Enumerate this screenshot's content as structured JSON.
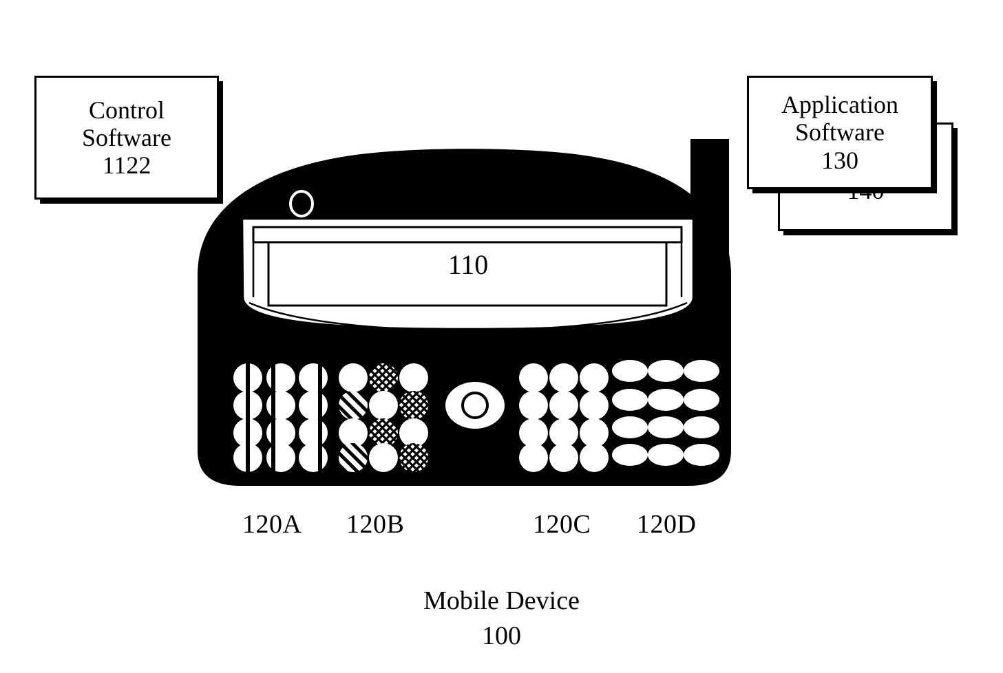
{
  "figure": {
    "caption_title": "Mobile Device",
    "caption_number": "100"
  },
  "callouts": {
    "control_software": {
      "line1": "Control",
      "line2": "Software",
      "number": "1122"
    },
    "application_software": {
      "line1": "Application",
      "line2": "Software",
      "number": "130"
    },
    "application_software_back": {
      "number": "140"
    }
  },
  "device": {
    "display": {
      "reference_number": "110"
    },
    "keypads": [
      {
        "id": "120A",
        "label": "120A",
        "rows": 4,
        "cols": 3,
        "key_shape": "circle-split",
        "patterns": [
          [
            "split-center",
            "split-left",
            "split-right"
          ],
          [
            "split-center",
            "split-left",
            "split-right"
          ],
          [
            "split-center",
            "split-left",
            "split-right"
          ],
          [
            "split-center",
            "split-left",
            "split-right"
          ]
        ]
      },
      {
        "id": "120B",
        "label": "120B",
        "rows": 4,
        "cols": 3,
        "key_shape": "circle",
        "patterns": [
          [
            "solid",
            "crosshatch",
            "solid"
          ],
          [
            "diagonal",
            "solid",
            "crosshatch"
          ],
          [
            "solid",
            "crosshatch",
            "solid"
          ],
          [
            "diagonal",
            "solid",
            "crosshatch"
          ]
        ]
      },
      {
        "id": "120C",
        "label": "120C",
        "rows": 4,
        "cols": 3,
        "key_shape": "circle",
        "patterns": [
          [
            "solid",
            "solid",
            "solid"
          ],
          [
            "solid",
            "solid",
            "solid"
          ],
          [
            "solid",
            "solid",
            "solid"
          ],
          [
            "solid",
            "solid",
            "solid"
          ]
        ]
      },
      {
        "id": "120D",
        "label": "120D",
        "rows": 4,
        "cols": 3,
        "key_shape": "ellipse-wide",
        "patterns": [
          [
            "solid",
            "solid",
            "solid"
          ],
          [
            "solid",
            "solid",
            "solid"
          ],
          [
            "solid",
            "solid",
            "solid"
          ],
          [
            "solid",
            "solid",
            "solid"
          ]
        ]
      }
    ],
    "components": {
      "antenna": "antenna",
      "earpiece": "earpiece",
      "jog_dial": "jog-dial"
    }
  },
  "colors": {
    "ink": "#000000",
    "paper": "#ffffff"
  }
}
